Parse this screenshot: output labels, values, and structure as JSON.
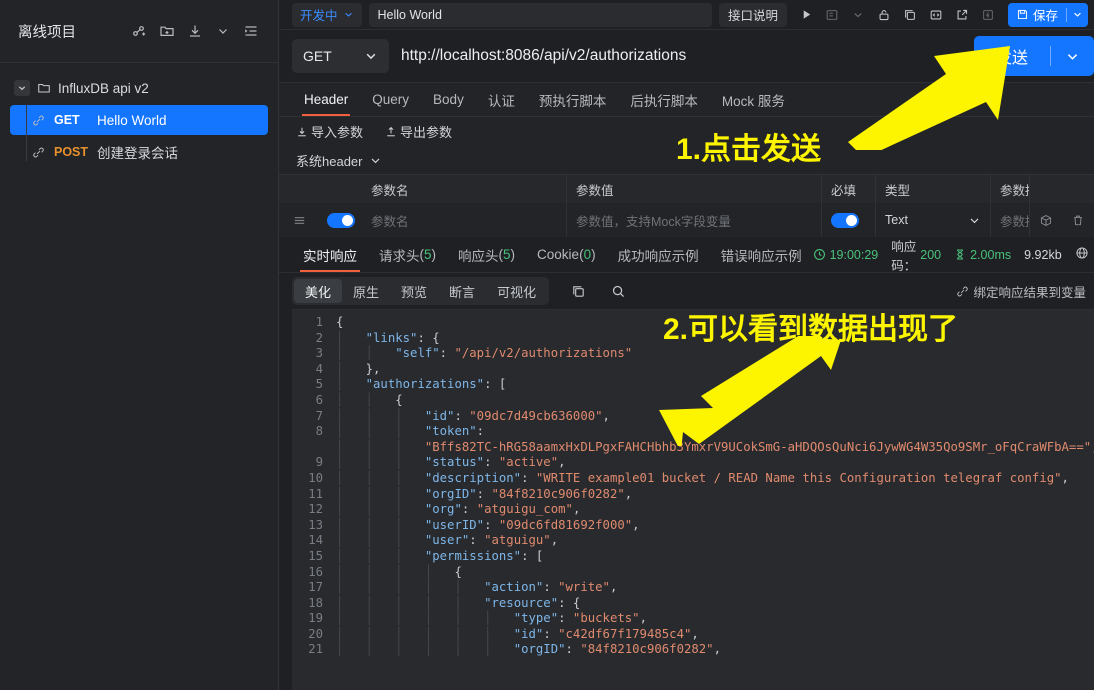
{
  "sidebar": {
    "title": "离线项目",
    "header_icons": [
      {
        "name": "share-node-icon",
        "glyph": "share"
      },
      {
        "name": "new-folder-icon",
        "glyph": "folder-plus"
      },
      {
        "name": "import-icon",
        "glyph": "download"
      },
      {
        "name": "chevron-down-icon",
        "glyph": "chevron-down"
      },
      {
        "name": "collapse-panel-icon",
        "glyph": "panel"
      }
    ],
    "folder": {
      "label": "InfluxDB api v2",
      "expanded": true
    },
    "items": [
      {
        "method": "GET",
        "label": "Hello World",
        "selected": true
      },
      {
        "method": "POST",
        "label": "创建登录会话",
        "selected": false
      }
    ]
  },
  "topbar": {
    "env": "开发中",
    "name_value": "Hello World",
    "doc_button": "接口说明",
    "icons": [
      {
        "name": "run-icon",
        "glyph": "play",
        "dim": false
      },
      {
        "name": "case-icon",
        "glyph": "case",
        "dim": true
      },
      {
        "name": "chevron-down-icon",
        "glyph": "chevron-down",
        "dim": true
      },
      {
        "name": "unlock-icon",
        "glyph": "unlock",
        "dim": false
      },
      {
        "name": "copy-icon",
        "glyph": "copy",
        "dim": false
      },
      {
        "name": "code-icon",
        "glyph": "code",
        "dim": false
      },
      {
        "name": "share-external-icon",
        "glyph": "external",
        "dim": false
      },
      {
        "name": "lightning-icon",
        "glyph": "bolt",
        "dim": true
      }
    ],
    "save_label": "保存"
  },
  "request": {
    "method": "GET",
    "url": "http://localhost:8086/api/v2/authorizations",
    "send_label": "发送",
    "tabs": [
      {
        "label": "Header",
        "active": true
      },
      {
        "label": "Query",
        "active": false
      },
      {
        "label": "Body",
        "active": false
      },
      {
        "label": "认证",
        "active": false
      },
      {
        "label": "预执行脚本",
        "active": false
      },
      {
        "label": "后执行脚本",
        "active": false
      },
      {
        "label": "Mock 服务",
        "active": false
      }
    ],
    "import_label": "导入参数",
    "export_label": "导出参数",
    "sys_header_label": "系统header",
    "table": {
      "columns": [
        "参数名",
        "参数值",
        "必填",
        "类型",
        "参数描述"
      ],
      "rows": [
        {
          "enabled": true,
          "name_placeholder": "参数名",
          "value_placeholder": "参数值，支持Mock字段变量",
          "required": true,
          "type": "Text",
          "desc_placeholder": "参数描述,用于生成文"
        }
      ]
    }
  },
  "response": {
    "tabs": [
      {
        "label": "实时响应",
        "count": null,
        "active": true
      },
      {
        "label": "请求头",
        "count": "5",
        "active": false
      },
      {
        "label": "响应头",
        "count": "5",
        "active": false
      },
      {
        "label": "Cookie",
        "count": "0",
        "active": false
      },
      {
        "label": "成功响应示例",
        "count": null,
        "active": false
      },
      {
        "label": "错误响应示例",
        "count": null,
        "active": false
      }
    ],
    "meta": {
      "time": "19:00:29",
      "status_label": "响应码：",
      "status_code": "200",
      "duration": "2.00ms",
      "size": "9.92kb"
    },
    "format_buttons": [
      {
        "label": "美化",
        "active": true
      },
      {
        "label": "原生",
        "active": false
      },
      {
        "label": "预览",
        "active": false
      },
      {
        "label": "断言",
        "active": false
      },
      {
        "label": "可视化",
        "active": false
      }
    ],
    "format_icons": [
      {
        "name": "copy-icon",
        "glyph": "copy"
      },
      {
        "name": "search-icon",
        "glyph": "search"
      }
    ],
    "bind_variable_label": "绑定响应结果到变量",
    "body_lines": [
      {
        "n": "1",
        "indent": 0,
        "parts": [
          {
            "t": "{",
            "c": "p"
          }
        ]
      },
      {
        "n": "2",
        "indent": 1,
        "parts": [
          {
            "t": "\"links\"",
            "c": "k"
          },
          {
            "t": ": {",
            "c": "p"
          }
        ]
      },
      {
        "n": "3",
        "indent": 2,
        "parts": [
          {
            "t": "\"self\"",
            "c": "k"
          },
          {
            "t": ": ",
            "c": "p"
          },
          {
            "t": "\"/api/v2/authorizations\"",
            "c": "s"
          }
        ]
      },
      {
        "n": "4",
        "indent": 1,
        "parts": [
          {
            "t": "},",
            "c": "p"
          }
        ]
      },
      {
        "n": "5",
        "indent": 1,
        "parts": [
          {
            "t": "\"authorizations\"",
            "c": "k"
          },
          {
            "t": ": [",
            "c": "p"
          }
        ]
      },
      {
        "n": "6",
        "indent": 2,
        "parts": [
          {
            "t": "{",
            "c": "p"
          }
        ]
      },
      {
        "n": "7",
        "indent": 3,
        "parts": [
          {
            "t": "\"id\"",
            "c": "k"
          },
          {
            "t": ": ",
            "c": "p"
          },
          {
            "t": "\"09dc7d49cb636000\"",
            "c": "s"
          },
          {
            "t": ",",
            "c": "p"
          }
        ]
      },
      {
        "n": "8",
        "indent": 3,
        "parts": [
          {
            "t": "\"token\"",
            "c": "k"
          },
          {
            "t": ":",
            "c": "p"
          }
        ]
      },
      {
        "n": "",
        "indent": 3,
        "parts": [
          {
            "t": "\"Bffs82TC-hRG58aamxHxDLPgxFAHCHbhb3YmxrV9UCokSmG-aHDQOsQuNci6JywWG4W35Qo9SMr_oFqCraWFbA==\"",
            "c": "s"
          },
          {
            "t": ",",
            "c": "p"
          }
        ]
      },
      {
        "n": "9",
        "indent": 3,
        "parts": [
          {
            "t": "\"status\"",
            "c": "k"
          },
          {
            "t": ": ",
            "c": "p"
          },
          {
            "t": "\"active\"",
            "c": "s"
          },
          {
            "t": ",",
            "c": "p"
          }
        ]
      },
      {
        "n": "10",
        "indent": 3,
        "parts": [
          {
            "t": "\"description\"",
            "c": "k"
          },
          {
            "t": ": ",
            "c": "p"
          },
          {
            "t": "\"WRITE example01 bucket / READ Name this Configuration telegraf config\"",
            "c": "s"
          },
          {
            "t": ",",
            "c": "p"
          }
        ]
      },
      {
        "n": "11",
        "indent": 3,
        "parts": [
          {
            "t": "\"orgID\"",
            "c": "k"
          },
          {
            "t": ": ",
            "c": "p"
          },
          {
            "t": "\"84f8210c906f0282\"",
            "c": "s"
          },
          {
            "t": ",",
            "c": "p"
          }
        ]
      },
      {
        "n": "12",
        "indent": 3,
        "parts": [
          {
            "t": "\"org\"",
            "c": "k"
          },
          {
            "t": ": ",
            "c": "p"
          },
          {
            "t": "\"atguigu_com\"",
            "c": "s"
          },
          {
            "t": ",",
            "c": "p"
          }
        ]
      },
      {
        "n": "13",
        "indent": 3,
        "parts": [
          {
            "t": "\"userID\"",
            "c": "k"
          },
          {
            "t": ": ",
            "c": "p"
          },
          {
            "t": "\"09dc6fd81692f000\"",
            "c": "s"
          },
          {
            "t": ",",
            "c": "p"
          }
        ]
      },
      {
        "n": "14",
        "indent": 3,
        "parts": [
          {
            "t": "\"user\"",
            "c": "k"
          },
          {
            "t": ": ",
            "c": "p"
          },
          {
            "t": "\"atguigu\"",
            "c": "s"
          },
          {
            "t": ",",
            "c": "p"
          }
        ]
      },
      {
        "n": "15",
        "indent": 3,
        "parts": [
          {
            "t": "\"permissions\"",
            "c": "k"
          },
          {
            "t": ": [",
            "c": "p"
          }
        ]
      },
      {
        "n": "16",
        "indent": 4,
        "parts": [
          {
            "t": "{",
            "c": "p"
          }
        ]
      },
      {
        "n": "17",
        "indent": 5,
        "parts": [
          {
            "t": "\"action\"",
            "c": "k"
          },
          {
            "t": ": ",
            "c": "p"
          },
          {
            "t": "\"write\"",
            "c": "s"
          },
          {
            "t": ",",
            "c": "p"
          }
        ]
      },
      {
        "n": "18",
        "indent": 5,
        "parts": [
          {
            "t": "\"resource\"",
            "c": "k"
          },
          {
            "t": ": {",
            "c": "p"
          }
        ]
      },
      {
        "n": "19",
        "indent": 6,
        "parts": [
          {
            "t": "\"type\"",
            "c": "k"
          },
          {
            "t": ": ",
            "c": "p"
          },
          {
            "t": "\"buckets\"",
            "c": "s"
          },
          {
            "t": ",",
            "c": "p"
          }
        ]
      },
      {
        "n": "20",
        "indent": 6,
        "parts": [
          {
            "t": "\"id\"",
            "c": "k"
          },
          {
            "t": ": ",
            "c": "p"
          },
          {
            "t": "\"c42df67f179485c4\"",
            "c": "s"
          },
          {
            "t": ",",
            "c": "p"
          }
        ]
      },
      {
        "n": "21",
        "indent": 6,
        "parts": [
          {
            "t": "\"orgID\"",
            "c": "k"
          },
          {
            "t": ": ",
            "c": "p"
          },
          {
            "t": "\"84f8210c906f0282\"",
            "c": "s"
          },
          {
            "t": ",",
            "c": "p"
          }
        ]
      }
    ]
  },
  "annotations": [
    {
      "name": "annotation-step-1",
      "text": "1.点击发送"
    },
    {
      "name": "annotation-step-2",
      "text": "2.可以看到数据出现了"
    }
  ],
  "colors": {
    "accent": "#1476ff",
    "annotation": "#fdf500",
    "get": "#49c17a",
    "post": "#e8912d",
    "tab_underline": "#f0603c"
  }
}
